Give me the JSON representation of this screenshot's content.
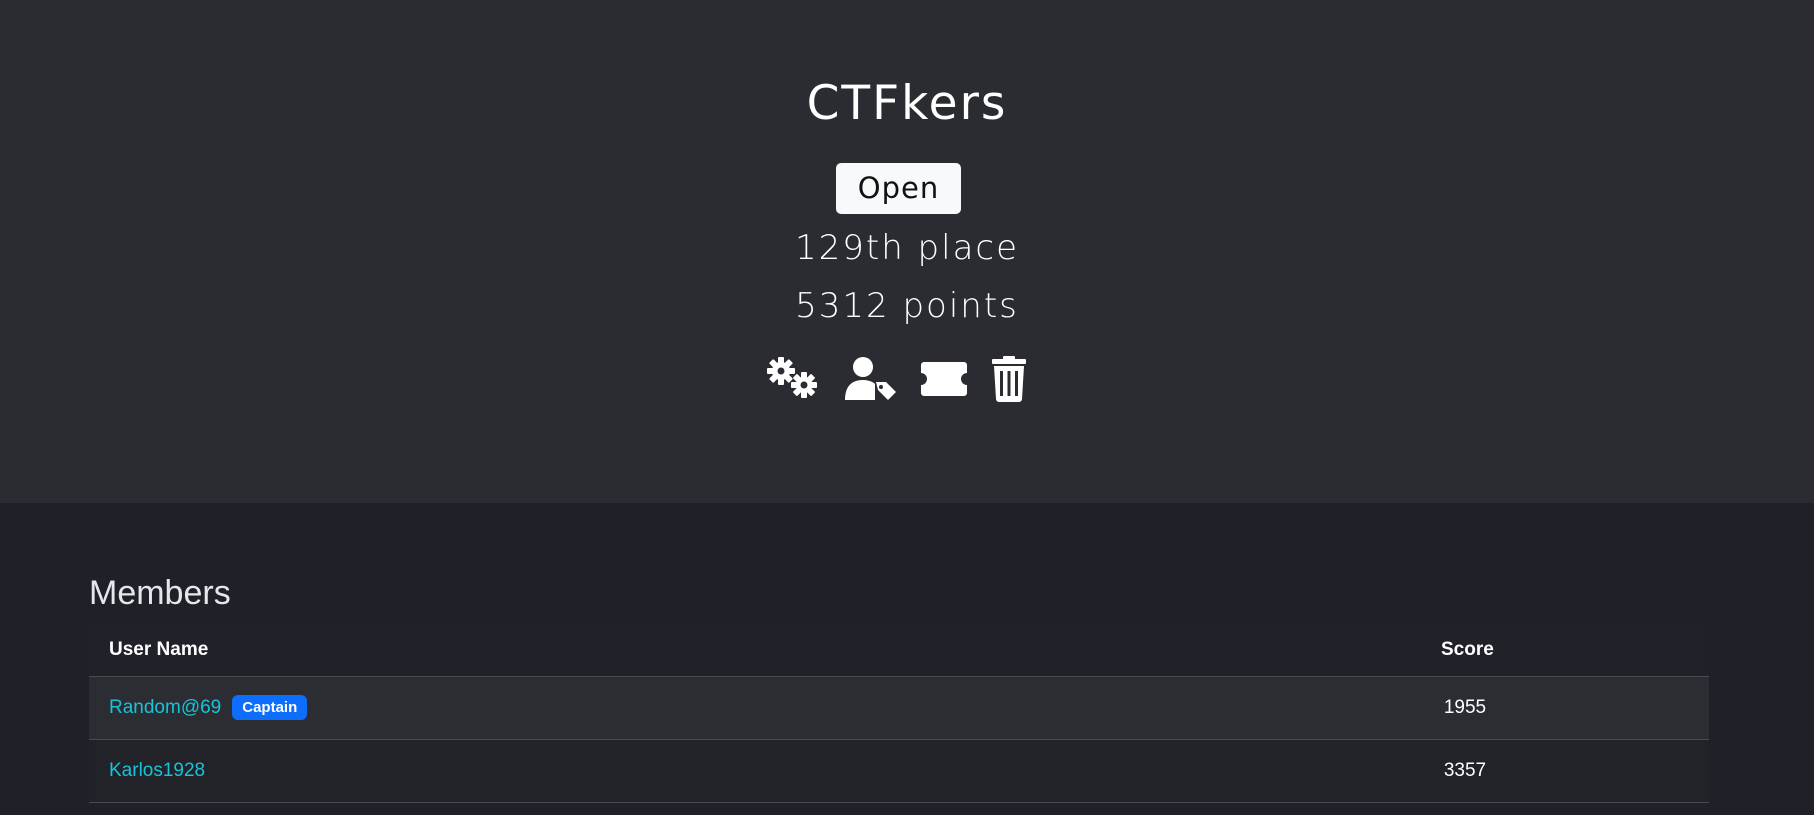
{
  "team": {
    "name": "CTFkers",
    "status": "Open",
    "place": "129th place",
    "points": "5312 points"
  },
  "actions": [
    {
      "icon": "gears-icon",
      "label": "Settings"
    },
    {
      "icon": "user-tag-icon",
      "label": "Captain"
    },
    {
      "icon": "ticket-icon",
      "label": "Invite"
    },
    {
      "icon": "trash-icon",
      "label": "Delete"
    }
  ],
  "members": {
    "title": "Members",
    "columns": {
      "user_name": "User Name",
      "score": "Score"
    },
    "rows": [
      {
        "name": "Random@69",
        "badge": "Captain",
        "score": "1955"
      },
      {
        "name": "Karlos1928",
        "badge": "",
        "score": "3357"
      }
    ]
  },
  "colors": {
    "hero_bg": "#2b2c32",
    "page_bg": "#202128",
    "link": "#17c3d9",
    "badge": "#0d6efd"
  }
}
